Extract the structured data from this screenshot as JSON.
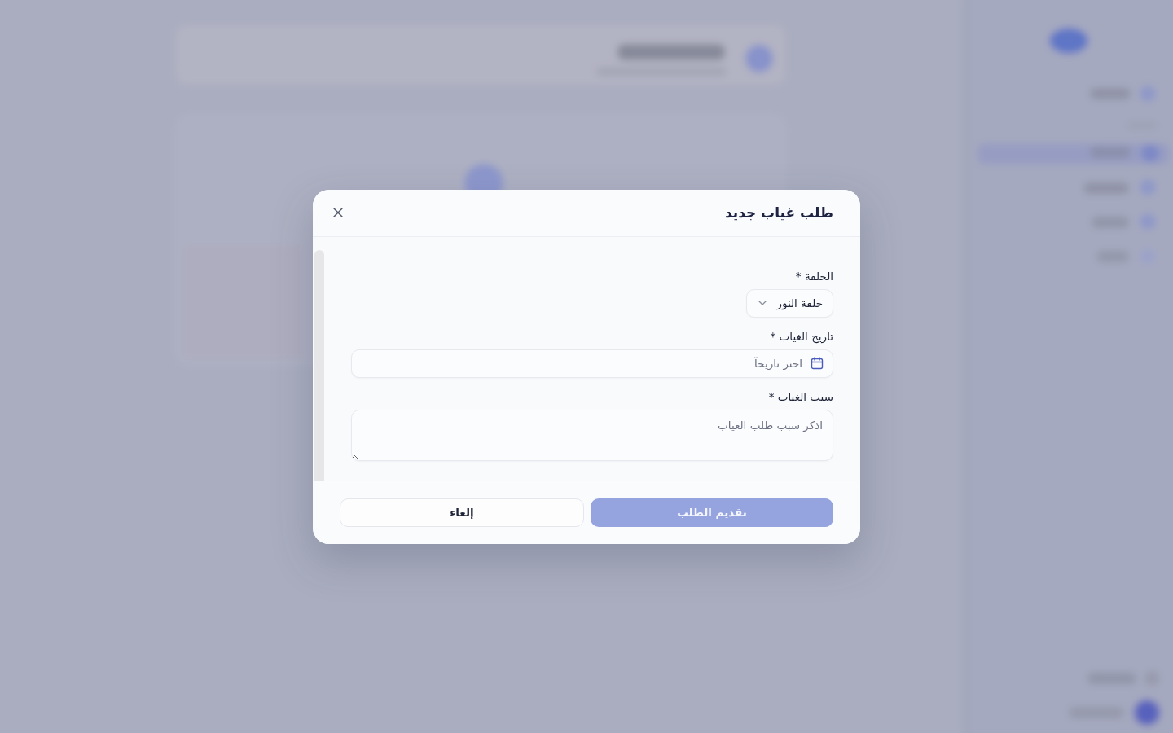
{
  "dialog": {
    "title": "طلب غياب جديد",
    "fields": [
      {
        "kind": "select",
        "label": "الحلقة *",
        "value": "حلقة النور"
      },
      {
        "kind": "date",
        "label": "تاريخ الغياب *",
        "placeholder": "اختر تاريخاً"
      },
      {
        "kind": "textarea",
        "label": "سبب الغياب *",
        "placeholder": "اذكر سبب طلب الغياب"
      }
    ],
    "buttons": [
      {
        "kind": "primary",
        "label": "تقديم الطلب",
        "disabled": true
      },
      {
        "kind": "secondary",
        "label": "إلغاء",
        "disabled": false
      }
    ]
  }
}
